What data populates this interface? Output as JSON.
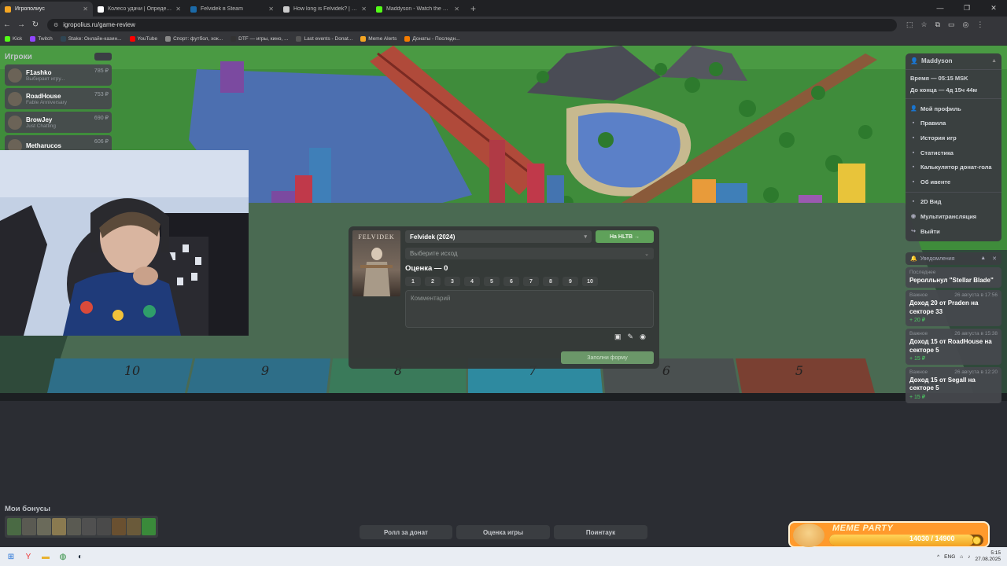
{
  "browser": {
    "tabs": [
      {
        "title": "Игрополиус",
        "color": "#f5a623",
        "active": true
      },
      {
        "title": "Колесо удачи | Определите по...",
        "color": "#ffffff",
        "active": false
      },
      {
        "title": "Felvidek в Steam",
        "color": "#1b6aa8",
        "active": false
      },
      {
        "title": "How long is Felvidek? | HowLo...",
        "color": "#cccccc",
        "active": false
      },
      {
        "title": "Maddyson - Watch the VOD on K...",
        "color": "#53fc18",
        "active": false
      }
    ],
    "new_tab": "+",
    "url": "igropolius.ru/game-review",
    "bookmarks": [
      {
        "label": "Kick",
        "color": "#53fc18"
      },
      {
        "label": "Twitch",
        "color": "#9146ff"
      },
      {
        "label": "Stake: Онлайн-казин...",
        "color": "#2f4553"
      },
      {
        "label": "YouTube",
        "color": "#ff0000"
      },
      {
        "label": "Спорт: футбол, хок...",
        "color": "#888888"
      },
      {
        "label": "DTF — игры, кино, ...",
        "color": "#333333"
      },
      {
        "label": "Last events - Donat...",
        "color": "#555555"
      },
      {
        "label": "Meme Alerts",
        "color": "#f5a623"
      },
      {
        "label": "Донаты - Последн...",
        "color": "#f57c00"
      }
    ]
  },
  "players": {
    "title": "Игроки",
    "list": [
      {
        "name": "F1ashko",
        "game": "Выбирает игру...",
        "balance": "785 ₽"
      },
      {
        "name": "RoadHouse",
        "game": "Fable Anniversary",
        "balance": "753 ₽"
      },
      {
        "name": "BrowJey",
        "game": "Just Chatting",
        "balance": "690 ₽"
      },
      {
        "name": "Metharucos",
        "game": "",
        "balance": "606 ₽"
      }
    ]
  },
  "menu": {
    "user": "Maddyson",
    "time": "Время — 05:15 MSK",
    "remaining": "До конца — 4д 15ч 44м",
    "items": [
      {
        "label": "Мой профиль",
        "icon": "👤"
      },
      {
        "label": "Правила",
        "icon": "▪"
      },
      {
        "label": "История игр",
        "icon": "▪"
      },
      {
        "label": "Статистика",
        "icon": "▪"
      },
      {
        "label": "Калькулятор донат-гола",
        "icon": "▪"
      },
      {
        "label": "Об ивенте",
        "icon": "▪"
      }
    ],
    "items2": [
      {
        "label": "2D Вид",
        "icon": "▪"
      },
      {
        "label": "Мультитрансляция",
        "icon": "◉"
      },
      {
        "label": "Выйти",
        "icon": "↪"
      }
    ]
  },
  "notifications": {
    "title": "Уведомления",
    "items": [
      {
        "type": "Последнее",
        "date": "",
        "body": "Реролльнул \"Stellar Blade\"",
        "amount": ""
      },
      {
        "type": "Важное",
        "date": "26 августа в 17:56",
        "body": "Доход 20 от Praden на секторе 33",
        "amount": "+ 20 ₽"
      },
      {
        "type": "Важное",
        "date": "26 августа в 15:38",
        "body": "Доход 15 от RoadHouse на секторе 5",
        "amount": "+ 15 ₽"
      },
      {
        "type": "Важное",
        "date": "26 августа в 12:20",
        "body": "Доход 15 от Segall на секторе 5",
        "amount": "+ 15 ₽"
      }
    ]
  },
  "modal": {
    "cover_title": "FELVIDEK",
    "game": "Felvidek (2024)",
    "hltb_label": "На HLTB →",
    "outcome_placeholder": "Выберите исход",
    "score_label": "Оценка — 0",
    "scores": [
      "1",
      "2",
      "3",
      "4",
      "5",
      "6",
      "7",
      "8",
      "9",
      "10"
    ],
    "comment_placeholder": "Комментарий",
    "submit_label": "Заполни форму"
  },
  "board": {
    "sectors": [
      "10",
      "9",
      "8",
      "7",
      "6",
      "5"
    ]
  },
  "bonuses": {
    "title": "Мои бонусы",
    "count": 10
  },
  "bottom_buttons": [
    "Ролл за донат",
    "Оценка игры",
    "Поинтаук"
  ],
  "meme_party": {
    "title": "MEME PARTY",
    "progress": "14030 / 14900",
    "fraction": 0.94
  },
  "taskbar": {
    "lang": "ENG",
    "time": "5:15",
    "date": "27.08.2025"
  },
  "colors": {
    "accent_green": "#5fa15a",
    "income_green": "#4cd064"
  }
}
